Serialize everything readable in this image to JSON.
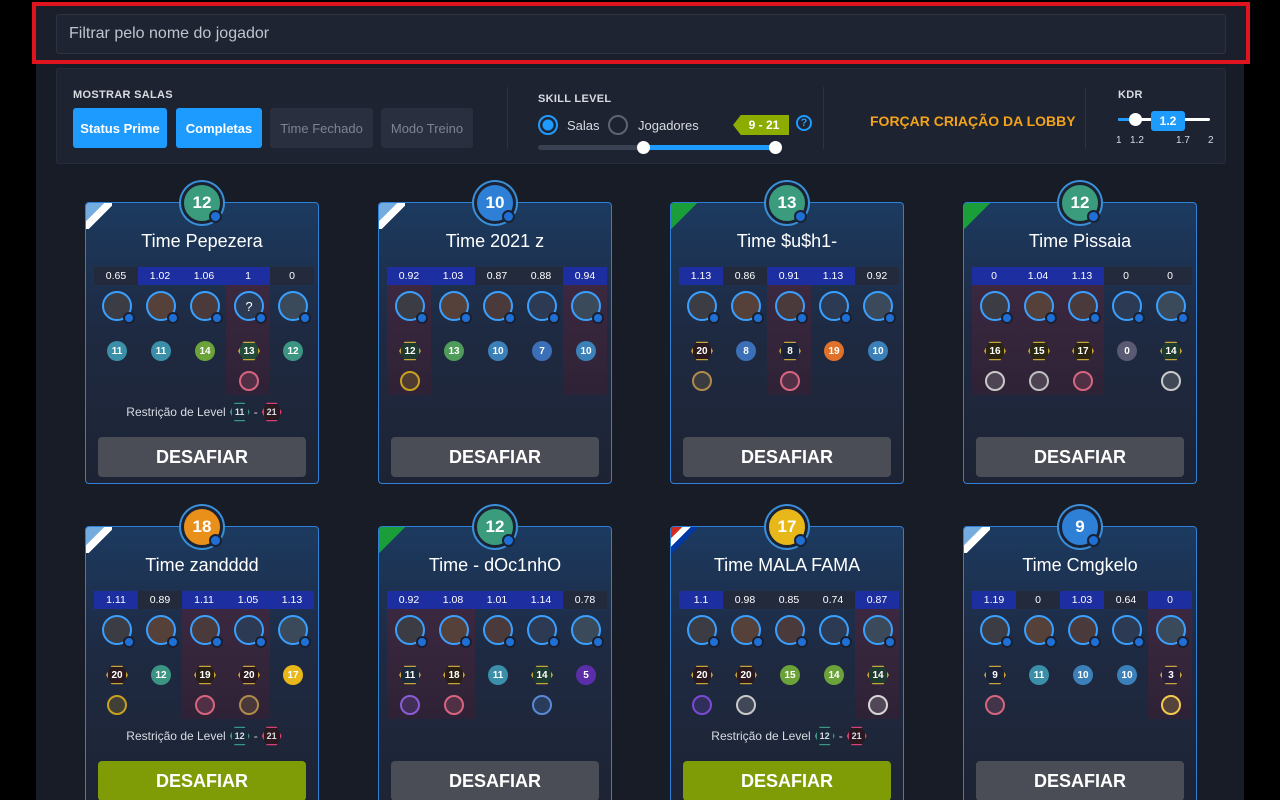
{
  "search": {
    "placeholder": "Filtrar pelo nome do jogador"
  },
  "filters": {
    "rooms_title": "MOSTRAR SALAS",
    "chips": [
      {
        "label": "Status Prime",
        "active": true
      },
      {
        "label": "Completas",
        "active": true
      },
      {
        "label": "Time Fechado",
        "active": false
      },
      {
        "label": "Modo Treino",
        "active": false
      }
    ],
    "skill_title": "SKILL LEVEL",
    "radio_salas": "Salas",
    "radio_jogadores": "Jogadores",
    "skill_range": "9 - 21",
    "help": "?",
    "force_lobby": "FORÇAR CRIAÇÃO DA LOBBY",
    "kdr_title": "KDR",
    "kdr_value": "1.2",
    "kdr_ticks": [
      "1",
      "1.2",
      "1.7",
      "2"
    ]
  },
  "colors": {
    "accent": "#1e9bff",
    "green": "#7f9c07",
    "orange": "#f3a31b",
    "red_frame": "#e0141e"
  },
  "cards": [
    {
      "team": "Time Pepezera",
      "level": "12",
      "level_color": "#3a9b7d",
      "flag": "argentina",
      "kdrs": [
        "0.65",
        "1.02",
        "1.06",
        "1",
        "0"
      ],
      "hi": [
        false,
        false,
        false,
        true,
        false
      ],
      "avatars": [
        "",
        "",
        "",
        "?",
        ""
      ],
      "levels": [
        "11",
        "11",
        "14",
        "13",
        "12"
      ],
      "lvl_colors": [
        "#3b8fa8",
        "#3b8fa8",
        "#6ba33a",
        "#234b38",
        "#3b9582"
      ],
      "hex": [
        false,
        false,
        false,
        true,
        false
      ],
      "medals": [
        "",
        "",
        "",
        "star",
        ""
      ],
      "restriction": {
        "label": "Restrição de Level",
        "min": "11",
        "sep": "-",
        "max": "21"
      },
      "button": "DESAFIAR",
      "button_green": false
    },
    {
      "team": "Time 2021 z",
      "level": "10",
      "level_color": "#2e7fd6",
      "flag": "argentina",
      "kdrs": [
        "0.92",
        "1.03",
        "0.87",
        "0.88",
        "0.94"
      ],
      "hi": [
        true,
        false,
        false,
        false,
        true
      ],
      "avatars": [
        "",
        "",
        "",
        "",
        ""
      ],
      "levels": [
        "12",
        "13",
        "10",
        "7",
        "10"
      ],
      "lvl_colors": [
        "#1f3a2e",
        "#4f9c5a",
        "#3b80b8",
        "#3b6fb8",
        "#3b80b8"
      ],
      "hex": [
        true,
        false,
        false,
        false,
        false
      ],
      "medals": [
        "wing",
        "",
        "",
        "",
        ""
      ],
      "restriction": null,
      "button": "DESAFIAR",
      "button_green": false
    },
    {
      "team": "Time $u$h1-",
      "level": "13",
      "level_color": "#3a9b7d",
      "flag": "brazil",
      "kdrs": [
        "1.13",
        "0.86",
        "0.91",
        "1.13",
        "0.92"
      ],
      "hi": [
        false,
        false,
        true,
        false,
        false
      ],
      "avatars": [
        "",
        "",
        "",
        "",
        ""
      ],
      "levels": [
        "20",
        "8",
        "8",
        "19",
        "10"
      ],
      "lvl_colors": [
        "#2a1a1f",
        "#3b6fb8",
        "#1a2238",
        "#e0712a",
        "#3b80b8"
      ],
      "hex": [
        true,
        false,
        true,
        false,
        false
      ],
      "medals": [
        "shield",
        "",
        "star",
        "",
        ""
      ],
      "restriction": null,
      "button": "DESAFIAR",
      "button_green": false
    },
    {
      "team": "Time Pissaia",
      "level": "12",
      "level_color": "#3a9b7d",
      "flag": "brazil",
      "kdrs": [
        "0",
        "1.04",
        "1.13",
        "0",
        "0"
      ],
      "hi": [
        true,
        true,
        true,
        false,
        false
      ],
      "avatars": [
        "",
        "",
        "",
        "",
        ""
      ],
      "levels": [
        "16",
        "15",
        "17",
        "0",
        "14"
      ],
      "lvl_colors": [
        "#2a2410",
        "#2a2810",
        "#2a2410",
        "#5a5a72",
        "#1f3a2e"
      ],
      "hex": [
        true,
        true,
        true,
        false,
        true
      ],
      "medals": [
        "trophy",
        "coin",
        "star",
        "",
        "trophy"
      ],
      "restriction": null,
      "button": "DESAFIAR",
      "button_green": false
    },
    {
      "team": "Time zandddd",
      "level": "18",
      "level_color": "#e8901a",
      "flag": "argentina",
      "kdrs": [
        "1.11",
        "0.89",
        "1.11",
        "1.05",
        "1.13"
      ],
      "hi": [
        false,
        false,
        true,
        true,
        false
      ],
      "avatars": [
        "",
        "",
        "",
        "",
        ""
      ],
      "levels": [
        "20",
        "12",
        "19",
        "20",
        "17"
      ],
      "lvl_colors": [
        "#2a1a1f",
        "#3b9582",
        "#2a1f14",
        "#2a1a1f",
        "#e8b81a"
      ],
      "hex": [
        true,
        false,
        true,
        true,
        false
      ],
      "medals": [
        "wing",
        "",
        "star",
        "shield",
        ""
      ],
      "restriction": {
        "label": "Restrição de Level",
        "min": "12",
        "sep": "-",
        "max": "21"
      },
      "button": "DESAFIAR",
      "button_green": true
    },
    {
      "team": "Time - dOc1nhO",
      "level": "12",
      "level_color": "#3a9b7d",
      "flag": "brazil",
      "kdrs": [
        "0.92",
        "1.08",
        "1.01",
        "1.14",
        "0.78"
      ],
      "hi": [
        true,
        true,
        false,
        false,
        false
      ],
      "avatars": [
        "",
        "",
        "",
        "",
        ""
      ],
      "levels": [
        "11",
        "18",
        "11",
        "14",
        "5"
      ],
      "lvl_colors": [
        "#1a2a3a",
        "#2a1f14",
        "#3b8fa8",
        "#1f3a2e",
        "#5a2ea8"
      ],
      "hex": [
        true,
        true,
        false,
        true,
        false
      ],
      "medals": [
        "skull",
        "star",
        "",
        "ball",
        ""
      ],
      "restriction": null,
      "button": "DESAFIAR",
      "button_green": false
    },
    {
      "team": "Time MALA FAMA",
      "level": "17",
      "level_color": "#e8b81a",
      "flag": "paraguay",
      "kdrs": [
        "1.1",
        "0.98",
        "0.85",
        "0.74",
        "0.87"
      ],
      "hi": [
        false,
        false,
        false,
        false,
        true
      ],
      "avatars": [
        "",
        "",
        "",
        "",
        ""
      ],
      "levels": [
        "20",
        "20",
        "15",
        "14",
        "14"
      ],
      "lvl_colors": [
        "#2a1a1f",
        "#2a1a1f",
        "#6ba33a",
        "#6ba33a",
        "#1f3a2e"
      ],
      "hex": [
        true,
        true,
        false,
        false,
        true
      ],
      "medals": [
        "badge",
        "trophy",
        "",
        "",
        "medal"
      ],
      "restriction": {
        "label": "Restrição de Level",
        "min": "12",
        "sep": "-",
        "max": "21"
      },
      "button": "DESAFIAR",
      "button_green": true
    },
    {
      "team": "Time Cmgkelo",
      "level": "9",
      "level_color": "#2e7fd6",
      "flag": "argentina",
      "kdrs": [
        "1.19",
        "0",
        "1.03",
        "0.64",
        "0"
      ],
      "hi": [
        false,
        false,
        false,
        false,
        true
      ],
      "avatars": [
        "",
        "",
        "",
        "",
        ""
      ],
      "levels": [
        "9",
        "11",
        "10",
        "10",
        "3"
      ],
      "lvl_colors": [
        "#1a2238",
        "#3b8fa8",
        "#3b80b8",
        "#3b80b8",
        "#2a1f3a"
      ],
      "hex": [
        true,
        false,
        false,
        false,
        true
      ],
      "medals": [
        "star",
        "",
        "",
        "",
        "star-y"
      ],
      "restriction": null,
      "button": "DESAFIAR",
      "button_green": false
    }
  ]
}
